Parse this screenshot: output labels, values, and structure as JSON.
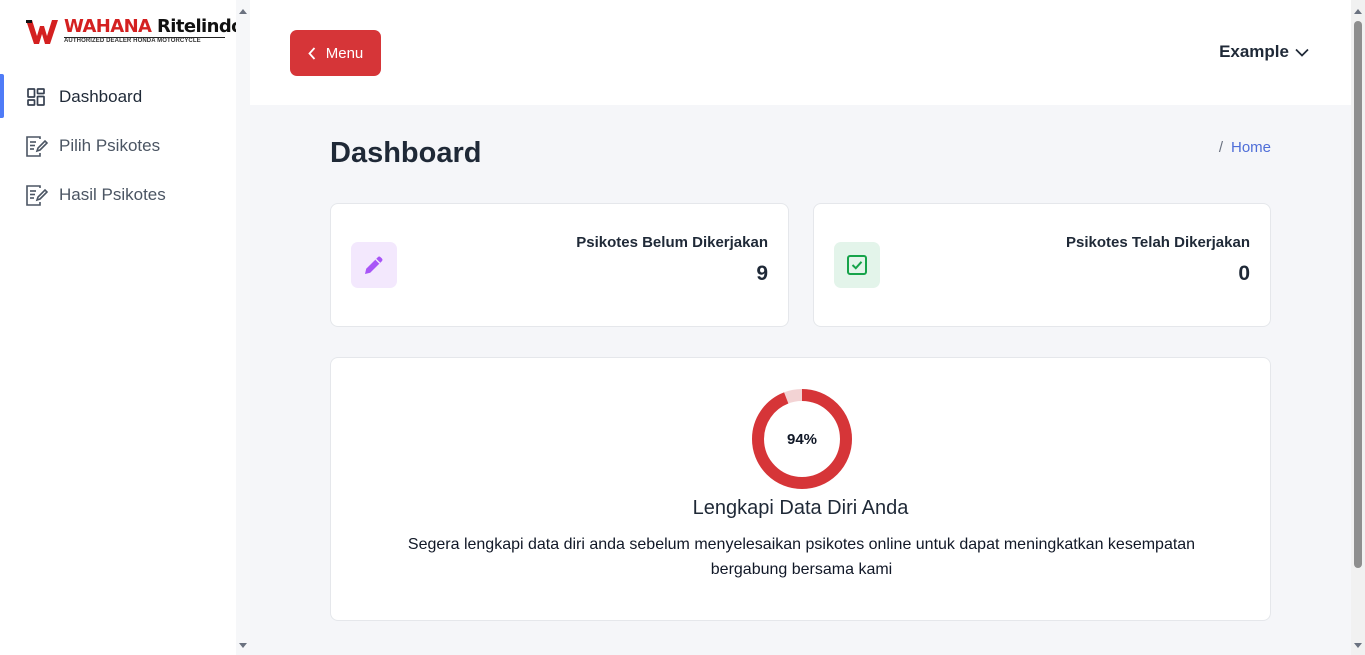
{
  "brand": {
    "name_part1": "WAHANA",
    "name_part2": "Ritelindo",
    "tagline": "AUTHORIZED DEALER HONDA MOTORCYCLE",
    "accent_color": "#d42020"
  },
  "sidebar": {
    "items": [
      {
        "label": "Dashboard",
        "icon": "dashboard-grid-icon",
        "active": true
      },
      {
        "label": "Pilih Psikotes",
        "icon": "document-edit-icon",
        "active": false
      },
      {
        "label": "Hasil Psikotes",
        "icon": "document-edit-icon",
        "active": false
      }
    ]
  },
  "topbar": {
    "menu_label": "Menu",
    "menu_color": "#d63538",
    "user_name": "Example"
  },
  "page": {
    "title": "Dashboard",
    "breadcrumb_sep": "/",
    "breadcrumb_home": "Home"
  },
  "stats": [
    {
      "label": "Psikotes Belum Dikerjakan",
      "value": "9",
      "icon": "pencil-icon",
      "icon_color": "#a855f7"
    },
    {
      "label": "Psikotes Telah Dikerjakan",
      "value": "0",
      "icon": "check-square-icon",
      "icon_color": "#16a34a"
    }
  ],
  "profile": {
    "progress_percent": 94,
    "progress_label": "94%",
    "progress_color": "#d63538",
    "title": "Lengkapi Data Diri Anda",
    "description": "Segera lengkapi data diri anda sebelum menyelesaikan psikotes online untuk dapat meningkatkan kesempatan bergabung bersama kami"
  }
}
